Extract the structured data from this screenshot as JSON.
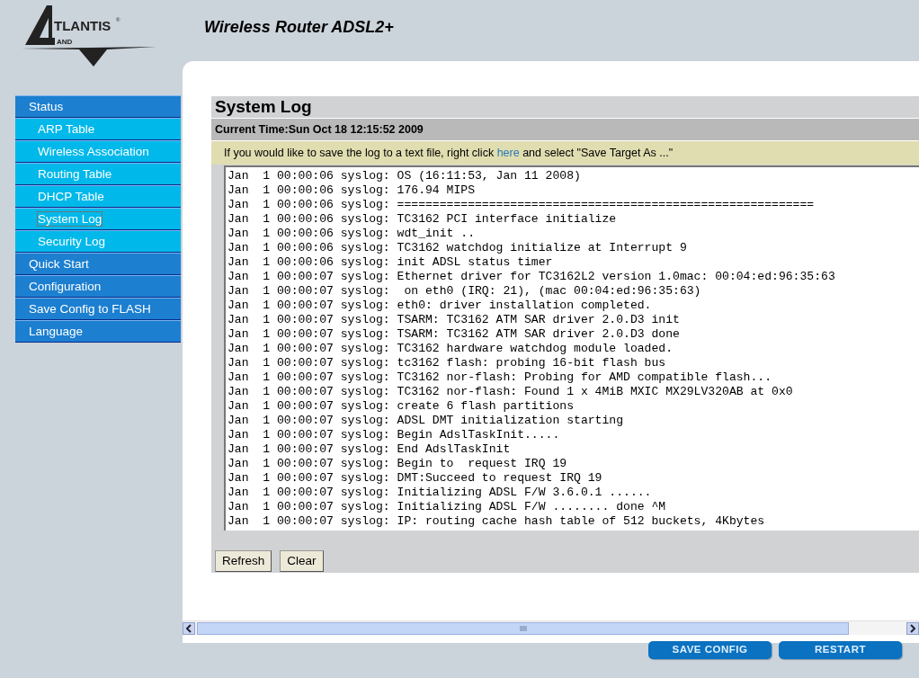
{
  "logo": {
    "word": "TLANTIS",
    "mark": "®",
    "sub": "AND"
  },
  "header": {
    "title": "Wireless Router ADSL2+"
  },
  "sidebar": {
    "items": [
      {
        "label": "Status",
        "kind": "section",
        "selected": false
      },
      {
        "label": "ARP Table",
        "kind": "sub",
        "selected": false
      },
      {
        "label": "Wireless Association",
        "kind": "sub",
        "selected": false
      },
      {
        "label": "Routing Table",
        "kind": "sub",
        "selected": false
      },
      {
        "label": "DHCP Table",
        "kind": "sub",
        "selected": false
      },
      {
        "label": "System Log",
        "kind": "sub",
        "selected": true
      },
      {
        "label": "Security Log",
        "kind": "sub",
        "selected": false
      },
      {
        "label": "Quick Start",
        "kind": "section",
        "selected": false
      },
      {
        "label": "Configuration",
        "kind": "section",
        "selected": false
      },
      {
        "label": "Save Config to FLASH",
        "kind": "section",
        "selected": false
      },
      {
        "label": "Language",
        "kind": "section",
        "selected": false
      }
    ]
  },
  "page": {
    "title": "System Log",
    "current_time": "Current Time:Sun Oct 18 12:15:52 2009",
    "notice": {
      "before": "If you would like to save the log to a text file, right click ",
      "link": "here",
      "after": " and select \"Save Target As ...\""
    },
    "log": [
      "Jan  1 00:00:06 syslog: OS (16:11:53, Jan 11 2008)",
      "Jan  1 00:00:06 syslog: 176.94 MIPS",
      "Jan  1 00:00:06 syslog: ===========================================================",
      "Jan  1 00:00:06 syslog: TC3162 PCI interface initialize",
      "Jan  1 00:00:06 syslog: wdt_init ..",
      "Jan  1 00:00:06 syslog: TC3162 watchdog initialize at Interrupt 9",
      "Jan  1 00:00:06 syslog: init ADSL status timer",
      "Jan  1 00:00:07 syslog: Ethernet driver for TC3162L2 version 1.0mac: 00:04:ed:96:35:63",
      "Jan  1 00:00:07 syslog:  on eth0 (IRQ: 21), (mac 00:04:ed:96:35:63)",
      "Jan  1 00:00:07 syslog: eth0: driver installation completed.",
      "Jan  1 00:00:07 syslog: TSARM: TC3162 ATM SAR driver 2.0.D3 init",
      "Jan  1 00:00:07 syslog: TSARM: TC3162 ATM SAR driver 2.0.D3 done",
      "Jan  1 00:00:07 syslog: TC3162 hardware watchdog module loaded.",
      "Jan  1 00:00:07 syslog: tc3162 flash: probing 16-bit flash bus",
      "Jan  1 00:00:07 syslog: TC3162 nor-flash: Probing for AMD compatible flash...",
      "Jan  1 00:00:07 syslog: TC3162 nor-flash: Found 1 x 4MiB MXIC MX29LV320AB at 0x0",
      "Jan  1 00:00:07 syslog: create 6 flash partitions",
      "Jan  1 00:00:07 syslog: ADSL DMT initialization starting",
      "Jan  1 00:00:07 syslog: Begin AdslTaskInit.....",
      "Jan  1 00:00:07 syslog: End AdslTaskInit",
      "Jan  1 00:00:07 syslog: Begin to  request IRQ 19",
      "Jan  1 00:00:07 syslog: DMT:Succeed to request IRQ 19",
      "Jan  1 00:00:07 syslog: Initializing ADSL F/W 3.6.0.1 ......",
      "Jan  1 00:00:07 syslog: Initializing ADSL F/W ........ done ^M",
      "Jan  1 00:00:07 syslog: IP: routing cache hash table of 512 buckets, 4Kbytes"
    ],
    "buttons": [
      "Refresh",
      "Clear"
    ]
  },
  "footer_buttons": [
    "SAVE CONFIG",
    "RESTART"
  ]
}
